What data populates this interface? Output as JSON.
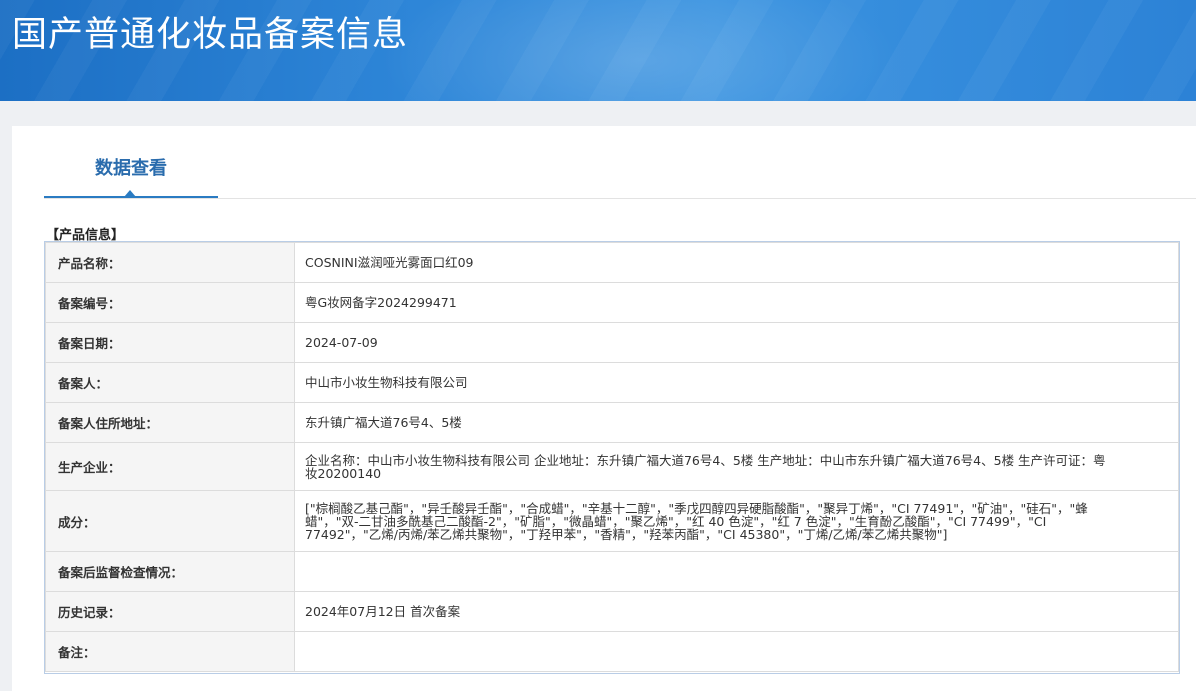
{
  "header": {
    "title": "国产普通化妆品备案信息"
  },
  "tabs": [
    {
      "label": "数据查看"
    }
  ],
  "section": {
    "title": "【产品信息】"
  },
  "rows": [
    {
      "label": "产品名称：",
      "value": "COSNINI滋润哑光雾面口红09"
    },
    {
      "label": "备案编号：",
      "value": "粤G妆网备字2024299471"
    },
    {
      "label": "备案日期：",
      "value": "2024-07-09"
    },
    {
      "label": "备案人：",
      "value": "中山市小妆生物科技有限公司"
    },
    {
      "label": "备案人住所地址：",
      "value": "东升镇广福大道76号4、5楼"
    },
    {
      "label": "生产企业：",
      "value": "企业名称：中山市小妆生物科技有限公司 企业地址：东升镇广福大道76号4、5楼 生产地址：中山市东升镇广福大道76号4、5楼 生产许可证：粤妆20200140"
    },
    {
      "label": "成分：",
      "value": "[\"棕榈酸乙基己酯\"，\"异壬酸异壬酯\"，\"合成蜡\"，\"辛基十二醇\"，\"季戊四醇四异硬脂酸酯\"，\"聚异丁烯\"，\"CI 77491\"，\"矿油\"，\"硅石\"，\"蜂蜡\"，\"双-二甘油多酰基己二酸酯-2\"，\"矿脂\"，\"微晶蜡\"，\"聚乙烯\"，\"红 40 色淀\"，\"红 7 色淀\"，\"生育酚乙酸酯\"，\"CI 77499\"，\"CI 77492\"，\"乙烯/丙烯/苯乙烯共聚物\"，\"丁羟甲苯\"，\"香精\"，\"羟苯丙酯\"，\"CI 45380\"，\"丁烯/乙烯/苯乙烯共聚物\"]"
    },
    {
      "label": "备案后监督检查情况：",
      "value": ""
    },
    {
      "label": "历史记录：",
      "value": "2024年07月12日 首次备案"
    },
    {
      "label": "备注：",
      "value": ""
    }
  ]
}
